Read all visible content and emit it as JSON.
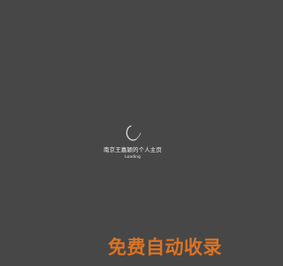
{
  "loader": {
    "site_title": "南京王嘉颖的个人主页",
    "status_text": "Loading"
  },
  "watermark": {
    "text": "免费自动收录",
    "color": "#e87722"
  },
  "colors": {
    "background": "#474747",
    "spinner": "#e6e6e6"
  }
}
